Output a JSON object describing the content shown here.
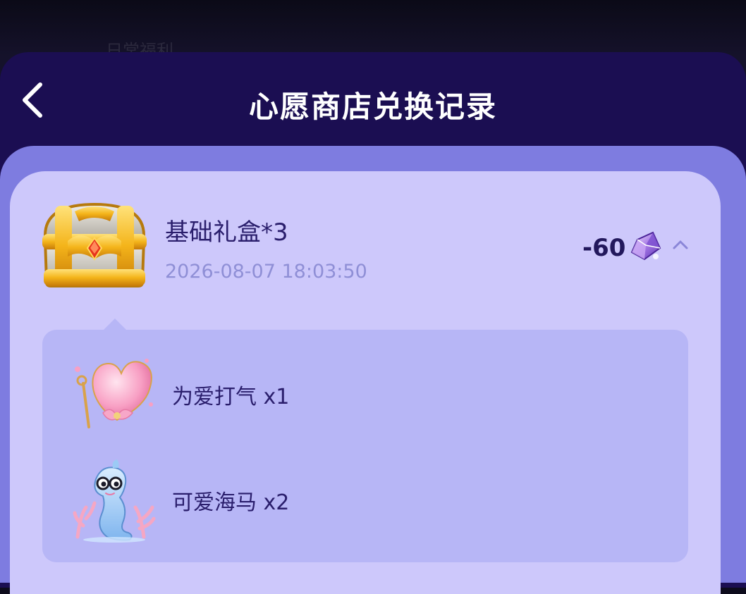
{
  "header": {
    "title": "心愿商店兑换记录",
    "back_icon": "chevron-left-icon"
  },
  "background": {
    "ghost_text": "日常福利"
  },
  "record": {
    "name": "基础礼盒*3",
    "time": "2026-08-07 18:03:50",
    "cost": "-60",
    "currency_icon": "purple-gem-icon",
    "expand_icon": "chevron-up-icon",
    "rewards": [
      {
        "label": "为爱打气 x1",
        "icon": "pink-heart-gift-icon"
      },
      {
        "label": "可爱海马 x2",
        "icon": "cute-seahorse-icon"
      }
    ]
  },
  "colors": {
    "sheet": "#1b0e52",
    "content": "#7e7ce0",
    "card": "#cdc8fb",
    "detail": "#b7b6f6",
    "text_dark": "#2a1e6c",
    "text_time": "#8f8fd6"
  }
}
